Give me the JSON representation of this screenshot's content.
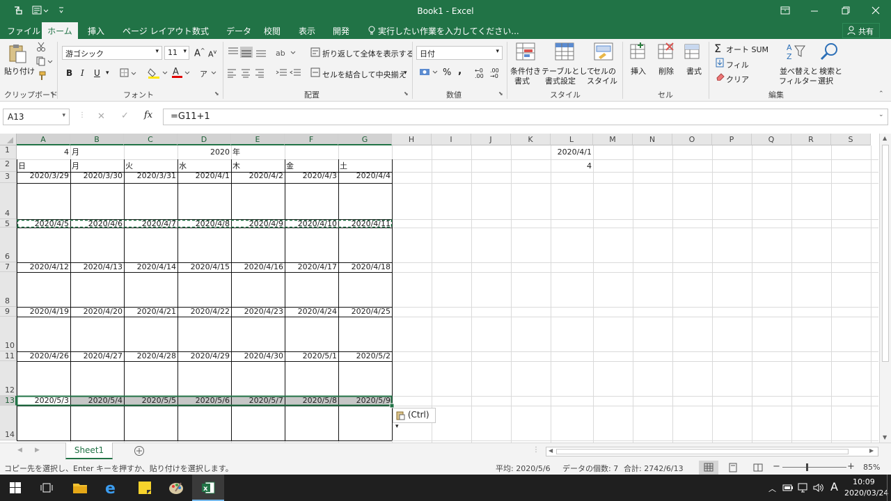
{
  "title": {
    "text": "Book1 - Excel",
    "share": "共有"
  },
  "tabs": [
    "ファイル",
    "ホーム",
    "挿入",
    "ページ レイアウト",
    "数式",
    "データ",
    "校閲",
    "表示",
    "開発"
  ],
  "tell_me": "実行したい作業を入力してください...",
  "ribbon": {
    "paste": "貼り付け",
    "font_name": "游ゴシック",
    "font_size": "11",
    "wrap": "折り返して全体を表示する",
    "merge": "セルを結合して中央揃え",
    "number_format": "日付",
    "cond_fmt": "条件付き",
    "cond_fmt2": "書式",
    "table_fmt": "テーブルとして",
    "table_fmt2": "書式設定",
    "cell_style": "セルの",
    "cell_style2": "スタイル",
    "insert": "挿入",
    "delete": "削除",
    "format": "書式",
    "autosum": "オート SUM",
    "fill": "フィル",
    "clear": "クリア",
    "sort": "並べ替えと",
    "sort2": "フィルター",
    "find": "検索と",
    "find2": "選択",
    "groups": [
      "クリップボード",
      "フォント",
      "配置",
      "数値",
      "スタイル",
      "セル",
      "編集"
    ]
  },
  "formula": {
    "namebox": "A13",
    "content": "=G11+1"
  },
  "columns": [
    "A",
    "B",
    "C",
    "D",
    "E",
    "F",
    "G",
    "H",
    "I",
    "J",
    "K",
    "L",
    "M",
    "N",
    "O",
    "P",
    "Q",
    "R",
    "S"
  ],
  "rows": [
    "1",
    "2",
    "3",
    "4",
    "5",
    "6",
    "7",
    "8",
    "9",
    "10",
    "11",
    "12",
    "13",
    "14"
  ],
  "header_row": {
    "month_num": "4",
    "month": "月",
    "year_num": "2020",
    "year": "年"
  },
  "weekdays": [
    "日",
    "月",
    "火",
    "水",
    "木",
    "金",
    "土"
  ],
  "weeks": [
    [
      "2020/3/29",
      "2020/3/30",
      "2020/3/31",
      "2020/4/1",
      "2020/4/2",
      "2020/4/3",
      "2020/4/4"
    ],
    [
      "2020/4/5",
      "2020/4/6",
      "2020/4/7",
      "2020/4/8",
      "2020/4/9",
      "2020/4/10",
      "2020/4/11"
    ],
    [
      "2020/4/12",
      "2020/4/13",
      "2020/4/14",
      "2020/4/15",
      "2020/4/16",
      "2020/4/17",
      "2020/4/18"
    ],
    [
      "2020/4/19",
      "2020/4/20",
      "2020/4/21",
      "2020/4/22",
      "2020/4/23",
      "2020/4/24",
      "2020/4/25"
    ],
    [
      "2020/4/26",
      "2020/4/27",
      "2020/4/28",
      "2020/4/29",
      "2020/4/30",
      "2020/5/1",
      "2020/5/2"
    ],
    [
      "2020/5/3",
      "2020/5/4",
      "2020/5/5",
      "2020/5/6",
      "2020/5/7",
      "2020/5/8",
      "2020/5/9"
    ]
  ],
  "L1": "2020/4/1",
  "L2": "4",
  "paste_options": "(Ctrl)",
  "sheet_tab": "Sheet1",
  "status": {
    "message": "コピー先を選択し、Enter キーを押すか、貼り付けを選択します。",
    "average": "平均: 2020/5/6",
    "count": "データの個数: 7",
    "sum": "合計: 2742/6/13",
    "zoom": "85%"
  },
  "taskbar": {
    "time": "10:09",
    "date": "2020/03/24",
    "ime": "A"
  },
  "colors": {
    "excel_green": "#217346"
  }
}
